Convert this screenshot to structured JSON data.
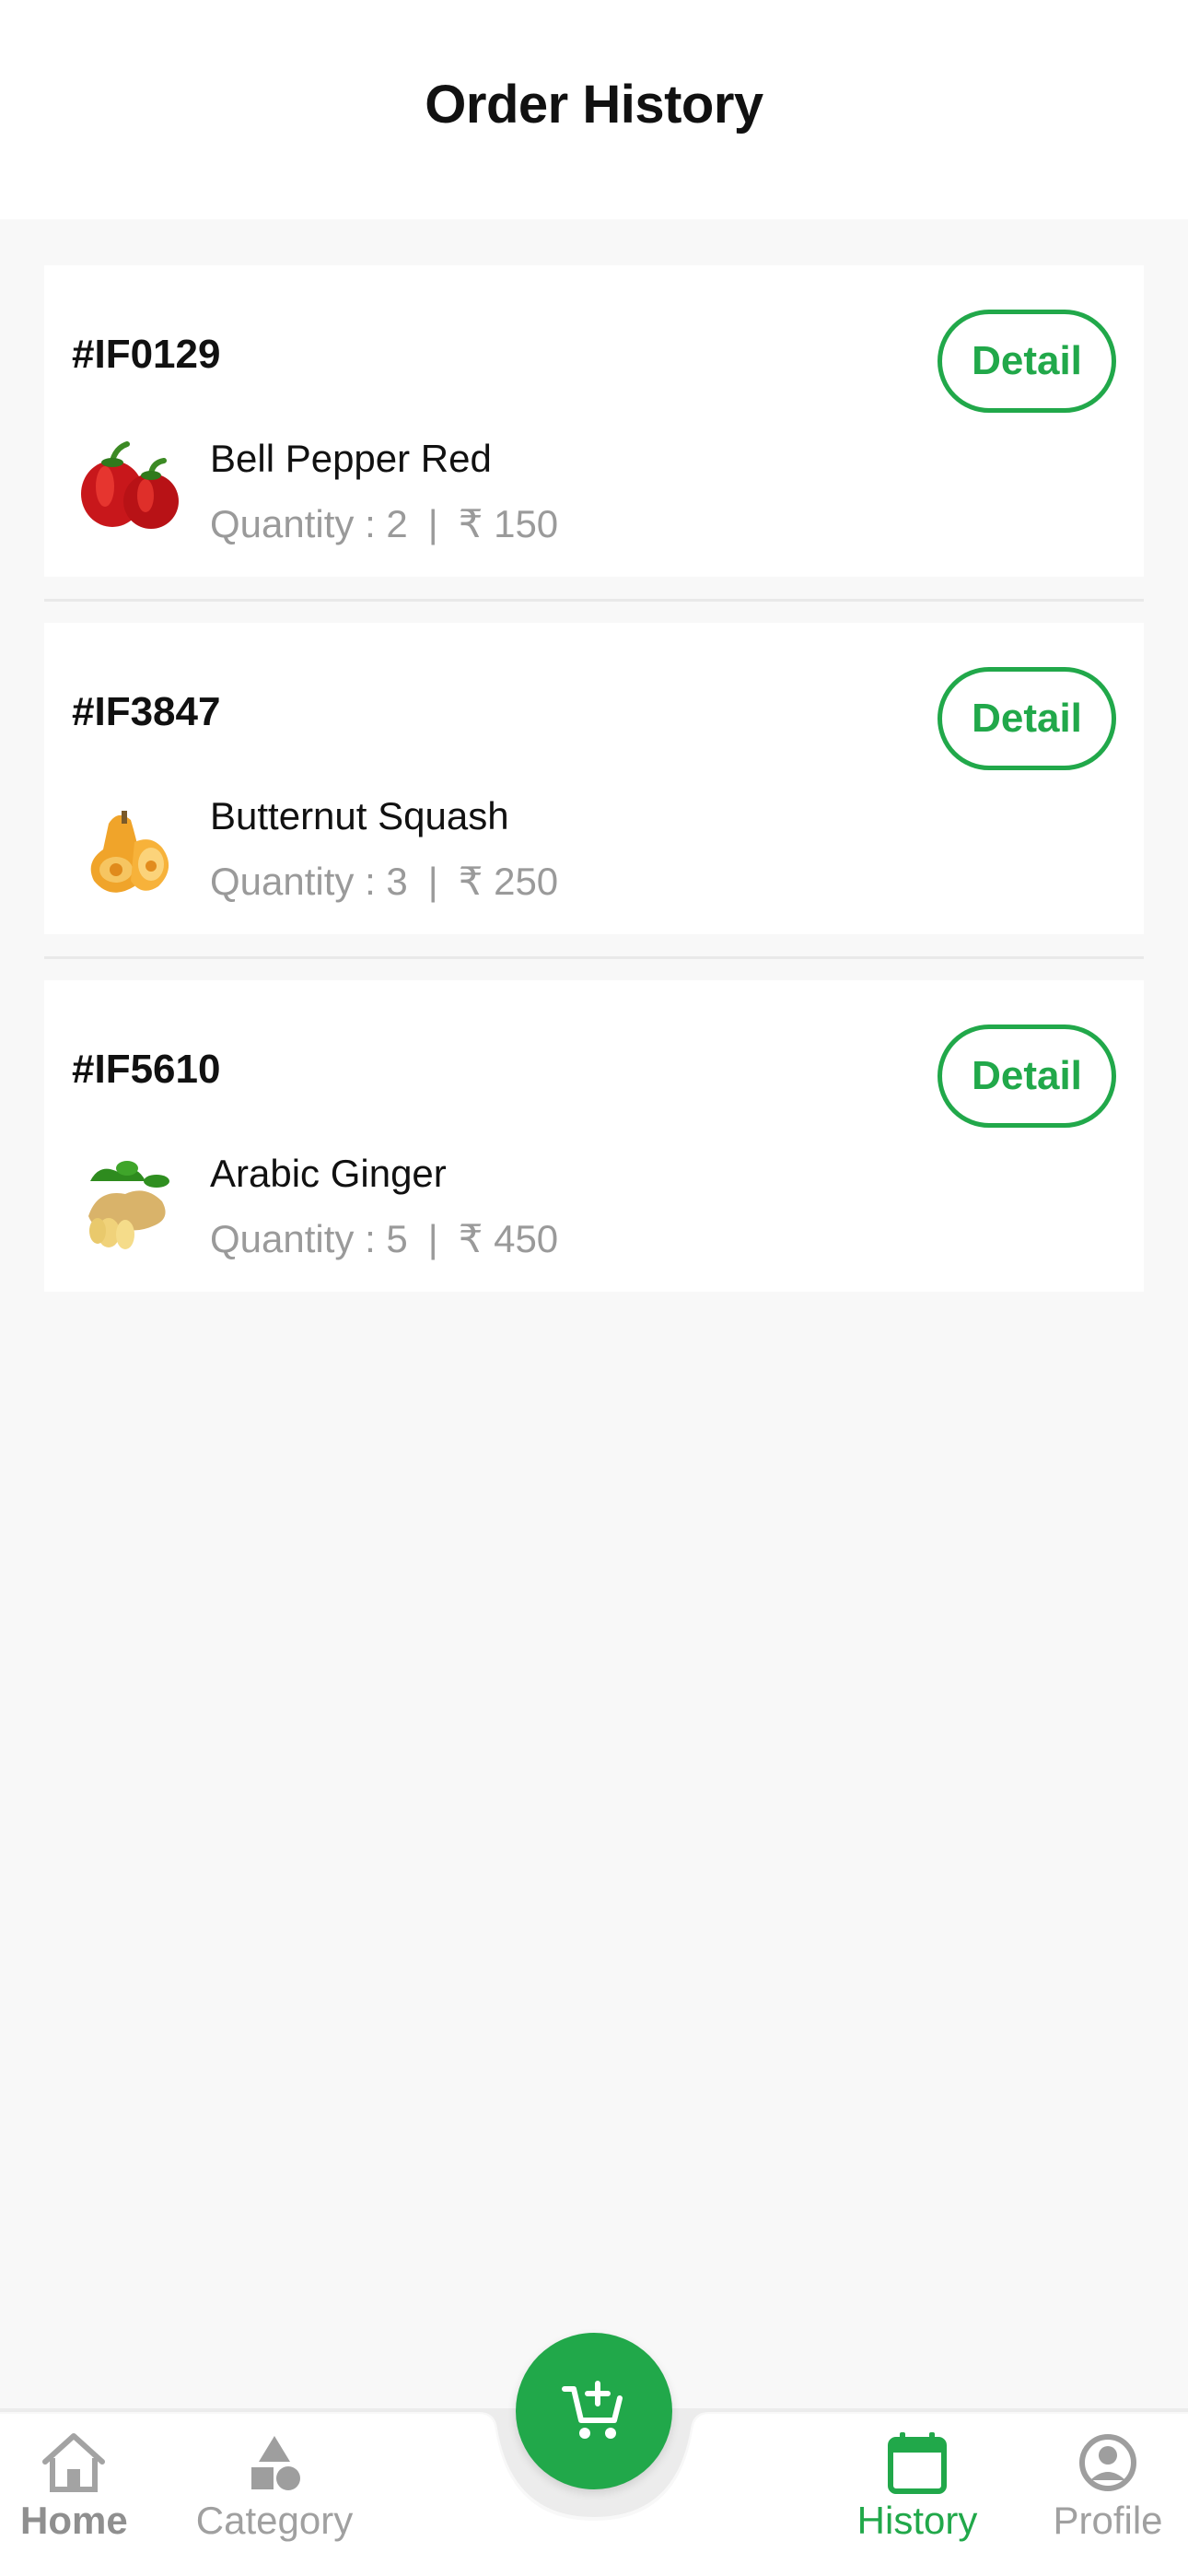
{
  "header": {
    "title": "Order History"
  },
  "orders": [
    {
      "id": "#IF0129",
      "detail_label": "Detail",
      "item_name": "Bell Pepper Red",
      "quantity_label": "Quantity : 2",
      "separator": "|",
      "price": "₹ 150",
      "image": "bell-pepper-icon"
    },
    {
      "id": "#IF3847",
      "detail_label": "Detail",
      "item_name": "Butternut Squash",
      "quantity_label": "Quantity : 3",
      "separator": "|",
      "price": "₹ 250",
      "image": "butternut-squash-icon"
    },
    {
      "id": "#IF5610",
      "detail_label": "Detail",
      "item_name": "Arabic Ginger",
      "quantity_label": "Quantity : 5",
      "separator": "|",
      "price": "₹ 450",
      "image": "ginger-icon"
    }
  ],
  "bottom_nav": {
    "items": [
      {
        "label": "Home",
        "icon": "home-icon",
        "state": "bold-gray"
      },
      {
        "label": "Category",
        "icon": "category-icon",
        "state": "inactive"
      },
      {
        "label": "History",
        "icon": "calendar-icon",
        "state": "active"
      },
      {
        "label": "Profile",
        "icon": "profile-icon",
        "state": "inactive"
      }
    ],
    "fab_icon": "add-to-cart-icon"
  },
  "colors": {
    "accent": "#21a84a",
    "muted_text": "#9a9a9a",
    "nav_inactive": "#9e9e9e",
    "background": "#f8f8f8"
  }
}
